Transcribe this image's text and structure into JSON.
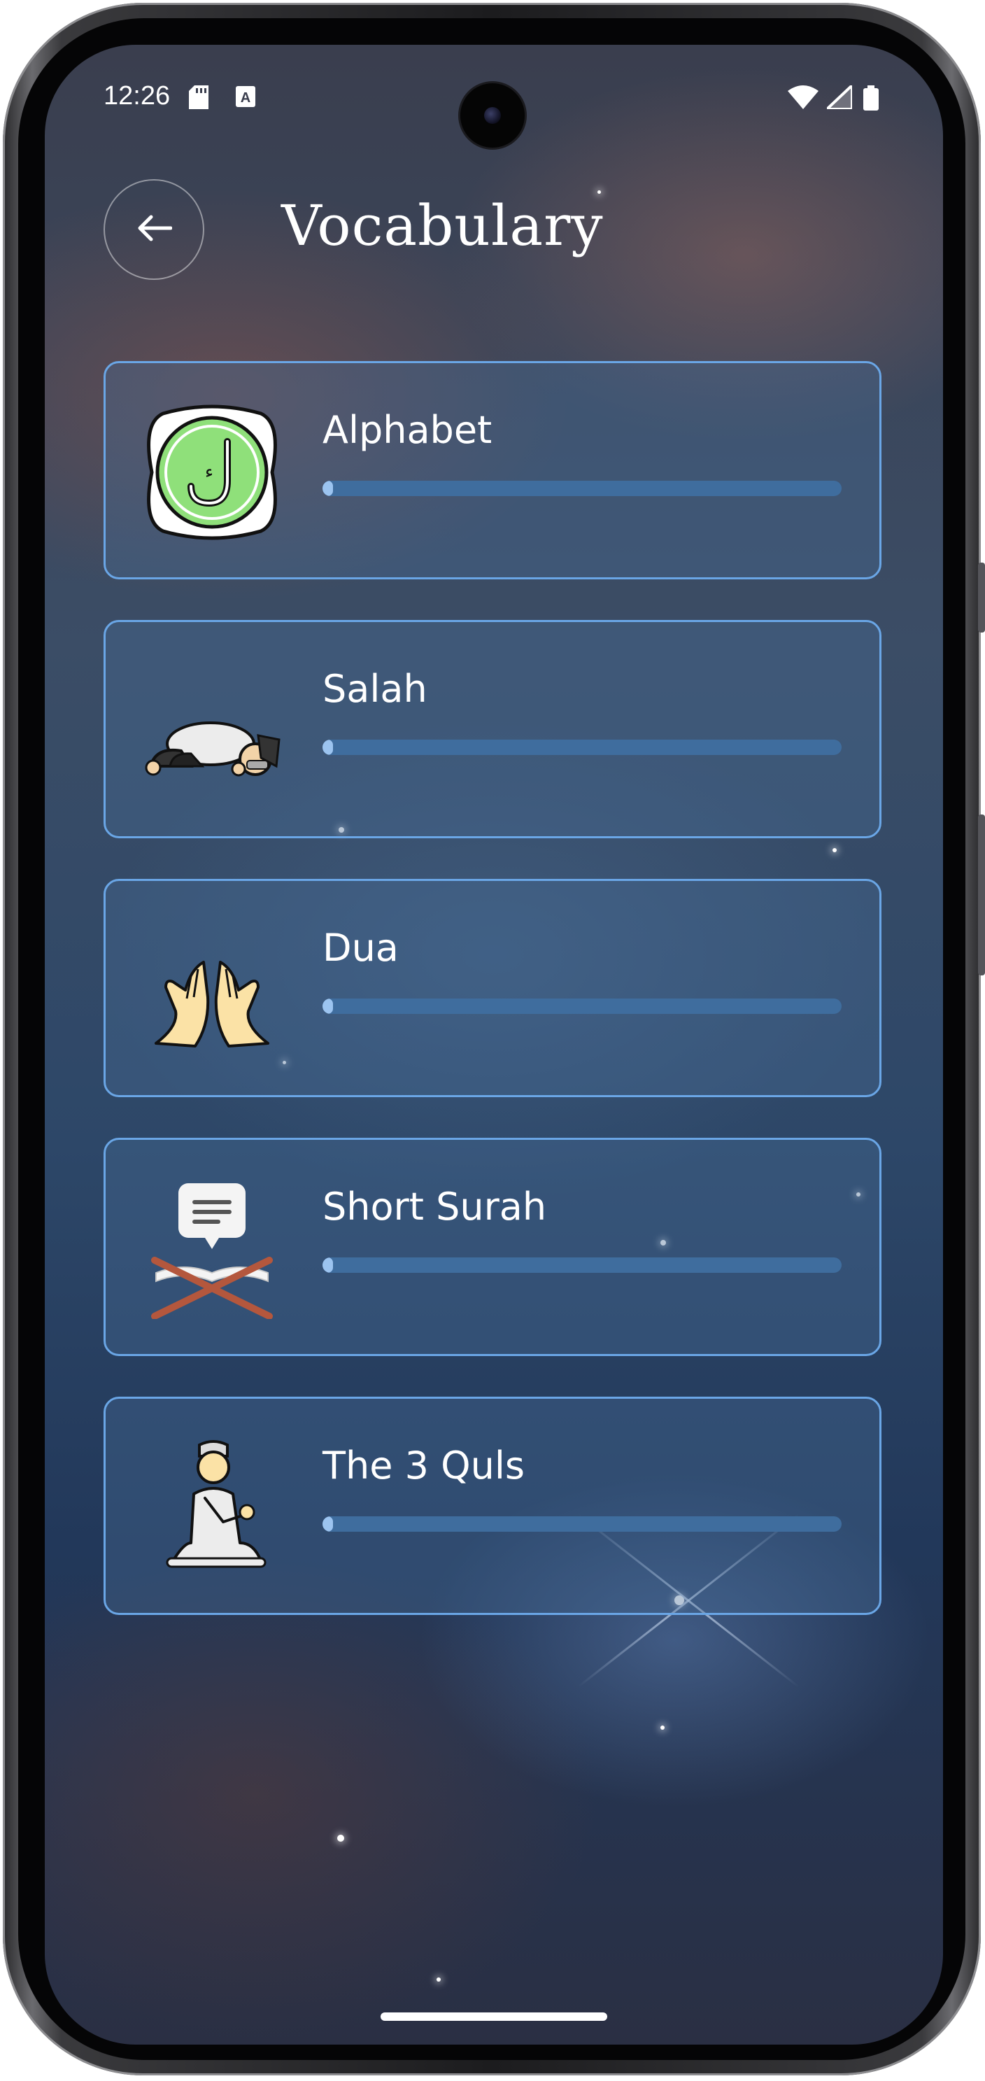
{
  "status_bar": {
    "time": "12:26",
    "icons": [
      "sd-card-icon",
      "text-recognition-icon",
      "wifi-icon",
      "cellular-signal-icon",
      "battery-icon"
    ]
  },
  "header": {
    "back_icon": "arrow-left-icon",
    "title": "Vocabulary"
  },
  "categories": [
    {
      "label": "Alphabet",
      "icon": "arabic-letter-badge-icon",
      "progress": 0.02
    },
    {
      "label": "Salah",
      "icon": "prostrating-man-icon",
      "progress": 0.02
    },
    {
      "label": "Dua",
      "icon": "raised-praying-hands-icon",
      "progress": 0.02
    },
    {
      "label": "Short Surah",
      "icon": "quran-on-stand-icon",
      "progress": 0.02
    },
    {
      "label": "The 3 Quls",
      "icon": "kneeling-praying-man-icon",
      "progress": 0.02
    }
  ],
  "colors": {
    "card_border": "#6aa6e6",
    "progress_track": "#3f6d9e",
    "progress_fill": "#9cc4f0",
    "badge_green": "#8fe07a"
  }
}
